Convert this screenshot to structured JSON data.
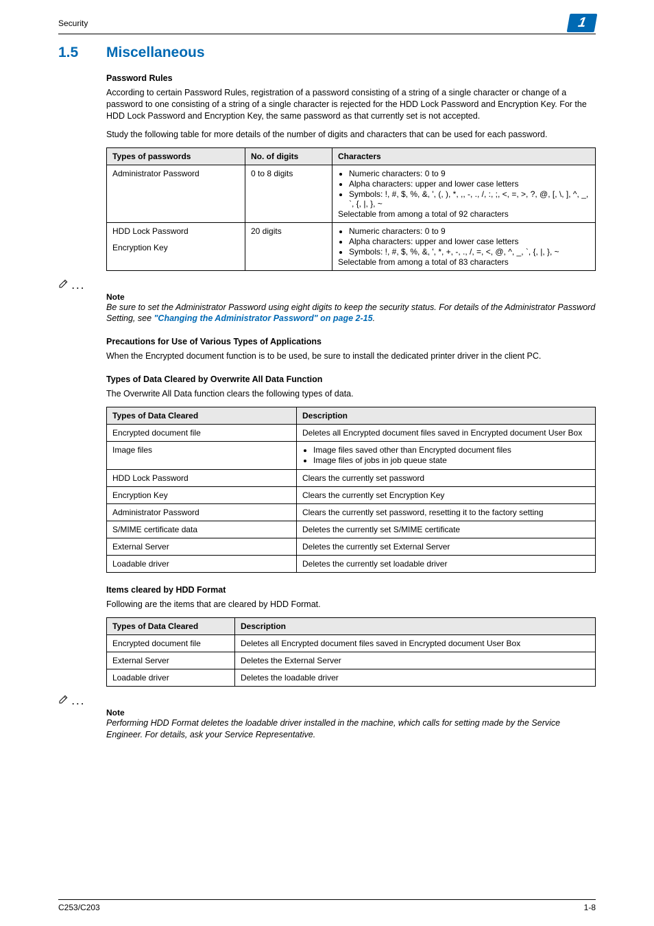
{
  "header": {
    "section_label": "Security",
    "chapter_badge": "1"
  },
  "section": {
    "number": "1.5",
    "title": "Miscellaneous"
  },
  "pw_rules": {
    "heading": "Password Rules",
    "p1": "According to certain Password Rules, registration of a password consisting of a string of a single character or change of a password to one consisting of a string of a single character is rejected for the HDD Lock Password and Encryption Key. For the HDD Lock Password and Encryption Key, the same password as that currently set is not accepted.",
    "p2": "Study the following table for more details of the number of digits and characters that can be used for each password.",
    "table": {
      "headers": [
        "Types of passwords",
        "No. of digits",
        "Characters"
      ],
      "rows": [
        {
          "type": "Administrator Password",
          "digits": "0 to 8 digits",
          "bullets": [
            "Numeric characters: 0 to 9",
            "Alpha characters: upper and lower case letters",
            "Symbols: !, #, $, %, &, ', (, ), *, ,, -, ., /, :, ;, <, =, >, ?, @, [, \\, ], ^, _, `, {, |, }, ~"
          ],
          "trailer": "Selectable from among a total of 92 characters"
        },
        {
          "type_a": "HDD Lock Password",
          "type_b": "Encryption Key",
          "digits": "20 digits",
          "bullets": [
            "Numeric characters: 0 to 9",
            "Alpha characters: upper and lower case letters",
            "Symbols: !, #, $, %, &, ', *, +, -, ., /, =, <, @, ^, _, `, {, |, }, ~"
          ],
          "trailer": "Selectable from among a total of 83 characters"
        }
      ]
    },
    "note_label": "Note",
    "note_text_a": "Be sure to set the Administrator Password using eight digits to keep the security status. For details of the Administrator Password Setting, see ",
    "note_link": "\"Changing the Administrator Password\" on page 2-15",
    "note_text_b": "."
  },
  "precautions": {
    "heading": "Precautions for Use of Various Types of Applications",
    "p": "When the Encrypted document function is to be used, be sure to install the dedicated printer driver in the client PC."
  },
  "overwrite": {
    "heading": "Types of Data Cleared by Overwrite All Data Function",
    "p": "The Overwrite All Data function clears the following types of data.",
    "table": {
      "headers": [
        "Types of Data Cleared",
        "Description"
      ],
      "rows": [
        {
          "c0": "Encrypted document file",
          "c1": "Deletes all Encrypted document files saved in Encrypted document User Box"
        },
        {
          "c0": "Image files",
          "bullets": [
            "Image files saved other than Encrypted document files",
            "Image files of jobs in job queue state"
          ]
        },
        {
          "c0": "HDD Lock Password",
          "c1": "Clears the currently set password"
        },
        {
          "c0": "Encryption Key",
          "c1": "Clears the currently set Encryption Key"
        },
        {
          "c0": "Administrator Password",
          "c1": "Clears the currently set password, resetting it to the factory setting"
        },
        {
          "c0": "S/MIME certificate data",
          "c1": "Deletes the currently set S/MIME certificate"
        },
        {
          "c0": "External Server",
          "c1": "Deletes the currently set External Server"
        },
        {
          "c0": "Loadable driver",
          "c1": "Deletes the currently set loadable driver"
        }
      ]
    }
  },
  "hdd_format": {
    "heading": "Items cleared by HDD Format",
    "p": "Following are the items that are cleared by HDD Format.",
    "table": {
      "headers": [
        "Types of Data Cleared",
        "Description"
      ],
      "rows": [
        {
          "c0": "Encrypted document file",
          "c1": "Deletes all Encrypted document files saved in Encrypted document User Box"
        },
        {
          "c0": "External Server",
          "c1": "Deletes the External Server"
        },
        {
          "c0": "Loadable driver",
          "c1": "Deletes the loadable driver"
        }
      ]
    },
    "note_label": "Note",
    "note_text": "Performing HDD Format deletes the loadable driver installed in the machine, which calls for setting made by the Service Engineer. For details, ask your Service Representative."
  },
  "footer": {
    "left": "C253/C203",
    "right": "1-8"
  },
  "icons": {
    "note_ellipsis": ". . ."
  }
}
